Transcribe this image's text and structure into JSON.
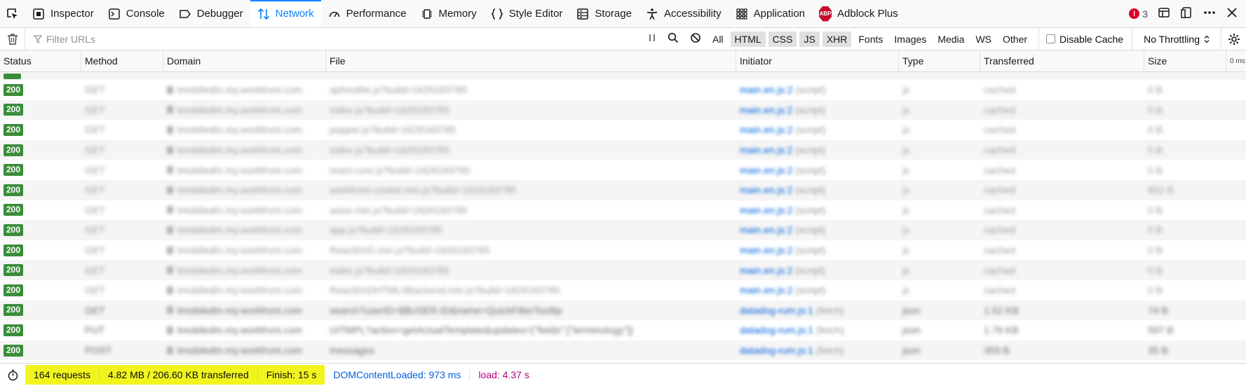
{
  "tabs": [
    {
      "label": "Inspector",
      "icon": "inspector-icon"
    },
    {
      "label": "Console",
      "icon": "console-icon"
    },
    {
      "label": "Debugger",
      "icon": "debugger-icon"
    },
    {
      "label": "Network",
      "icon": "network-icon",
      "selected": true
    },
    {
      "label": "Performance",
      "icon": "performance-icon"
    },
    {
      "label": "Memory",
      "icon": "memory-icon"
    },
    {
      "label": "Style Editor",
      "icon": "style-editor-icon"
    },
    {
      "label": "Storage",
      "icon": "storage-icon"
    },
    {
      "label": "Accessibility",
      "icon": "accessibility-icon"
    },
    {
      "label": "Application",
      "icon": "application-icon"
    },
    {
      "label": "Adblock Plus",
      "icon": "adblock-plus-icon"
    }
  ],
  "adblock_icon_text": "ABP",
  "error_count": "3",
  "filter": {
    "placeholder": "Filter URLs",
    "value": ""
  },
  "request_types": [
    {
      "label": "All",
      "active": false
    },
    {
      "label": "HTML",
      "active": true
    },
    {
      "label": "CSS",
      "active": true
    },
    {
      "label": "JS",
      "active": true
    },
    {
      "label": "XHR",
      "active": true
    },
    {
      "label": "Fonts",
      "active": false
    },
    {
      "label": "Images",
      "active": false
    },
    {
      "label": "Media",
      "active": false
    },
    {
      "label": "WS",
      "active": false
    },
    {
      "label": "Other",
      "active": false
    }
  ],
  "disable_cache_label": "Disable Cache",
  "throttling_label": "No Throttling",
  "columns": {
    "status": "Status",
    "method": "Method",
    "domain": "Domain",
    "file": "File",
    "initiator": "Initiator",
    "type": "Type",
    "transferred": "Transferred",
    "size": "Size",
    "waterfall": "0 ms"
  },
  "rows": [
    {
      "status": "200",
      "method": "GET",
      "domain": "tmobiledm.my.workfront.com",
      "file": "aphrodite.js?build=1629183785",
      "initiator": "main.en.js:2",
      "cause": "(script)",
      "type": "js",
      "transferred": "cached",
      "size": "0 B",
      "faded": true
    },
    {
      "status": "200",
      "method": "GET",
      "domain": "tmobiledm.my.workfront.com",
      "file": "index.js?build=1629183785",
      "initiator": "main.en.js:2",
      "cause": "(script)",
      "type": "js",
      "transferred": "cached",
      "size": "0 B",
      "faded": true
    },
    {
      "status": "200",
      "method": "GET",
      "domain": "tmobiledm.my.workfront.com",
      "file": "popper.js?build=1629183785",
      "initiator": "main.en.js:2",
      "cause": "(script)",
      "type": "js",
      "transferred": "cached",
      "size": "0 B",
      "faded": true
    },
    {
      "status": "200",
      "method": "GET",
      "domain": "tmobiledm.my.workfront.com",
      "file": "index.js?build=1629183785",
      "initiator": "main.en.js:2",
      "cause": "(script)",
      "type": "js",
      "transferred": "cached",
      "size": "0 B",
      "faded": true
    },
    {
      "status": "200",
      "method": "GET",
      "domain": "tmobiledm.my.workfront.com",
      "file": "react-core.js?build=1629183785",
      "initiator": "main.en.js:2",
      "cause": "(script)",
      "type": "js",
      "transferred": "cached",
      "size": "0 B",
      "faded": true
    },
    {
      "status": "200",
      "method": "GET",
      "domain": "tmobiledm.my.workfront.com",
      "file": "workfront-cookie.min.js?build=1629183785",
      "initiator": "main.en.js:2",
      "cause": "(script)",
      "type": "js",
      "transferred": "cached",
      "size": "652 B",
      "faded": true
    },
    {
      "status": "200",
      "method": "GET",
      "domain": "tmobiledm.my.workfront.com",
      "file": "axios.min.js?build=1629183785",
      "initiator": "main.en.js:2",
      "cause": "(script)",
      "type": "js",
      "transferred": "cached",
      "size": "0 B",
      "faded": true
    },
    {
      "status": "200",
      "method": "GET",
      "domain": "tmobiledm.my.workfront.com",
      "file": "app.js?build=1629183785",
      "initiator": "main.en.js:2",
      "cause": "(script)",
      "type": "js",
      "transferred": "cached",
      "size": "0 B",
      "faded": true
    },
    {
      "status": "200",
      "method": "GET",
      "domain": "tmobiledm.my.workfront.com",
      "file": "ReactDnD.min.js?build=1629183785",
      "initiator": "main.en.js:2",
      "cause": "(script)",
      "type": "js",
      "transferred": "cached",
      "size": "0 B",
      "faded": true
    },
    {
      "status": "200",
      "method": "GET",
      "domain": "tmobiledm.my.workfront.com",
      "file": "index.js?build=1629183785",
      "initiator": "main.en.js:2",
      "cause": "(script)",
      "type": "js",
      "transferred": "cached",
      "size": "0 B",
      "faded": true
    },
    {
      "status": "200",
      "method": "GET",
      "domain": "tmobiledm.my.workfront.com",
      "file": "ReactDnDHTML5Backend.min.js?build=1629183785",
      "initiator": "main.en.js:2",
      "cause": "(script)",
      "type": "js",
      "transferred": "cached",
      "size": "0 B",
      "faded": true
    },
    {
      "status": "200",
      "method": "GET",
      "domain": "tmobiledm.my.workfront.com",
      "file": "search?userID=$$USER.ID&name=QuickFilterTooltip",
      "initiator": "datadog-rum.js:1",
      "cause": "(fetch)",
      "type": "json",
      "transferred": "1.52 KB",
      "size": "74 B",
      "faded": false
    },
    {
      "status": "200",
      "method": "PUT",
      "domain": "tmobiledm.my.workfront.com",
      "file": "UITMPL?action=getActualTemplate&updates={\"fields\":[\"terminology\"]}",
      "initiator": "datadog-rum.js:1",
      "cause": "(fetch)",
      "type": "json",
      "transferred": "1.76 KB",
      "size": "597 B",
      "faded": false
    },
    {
      "status": "200",
      "method": "POST",
      "domain": "tmobiledm.my.workfront.com",
      "file": "messages",
      "initiator": "datadog-rum.js:1",
      "cause": "(fetch)",
      "type": "json",
      "transferred": "359 B",
      "size": "35 B",
      "faded": false
    }
  ],
  "summary": {
    "requests": "164 requests",
    "transferred": "4.82 MB / 206.60 KB transferred",
    "finish": "Finish: 15 s",
    "dom_content_loaded": "DOMContentLoaded: 973 ms",
    "load": "load: 4.37 s"
  },
  "colors": {
    "accent": "#0a84ff",
    "status_ok": "#3a8d3a",
    "highlight": "#f2f51d",
    "dcl": "#0060df",
    "load": "#b5007f"
  }
}
